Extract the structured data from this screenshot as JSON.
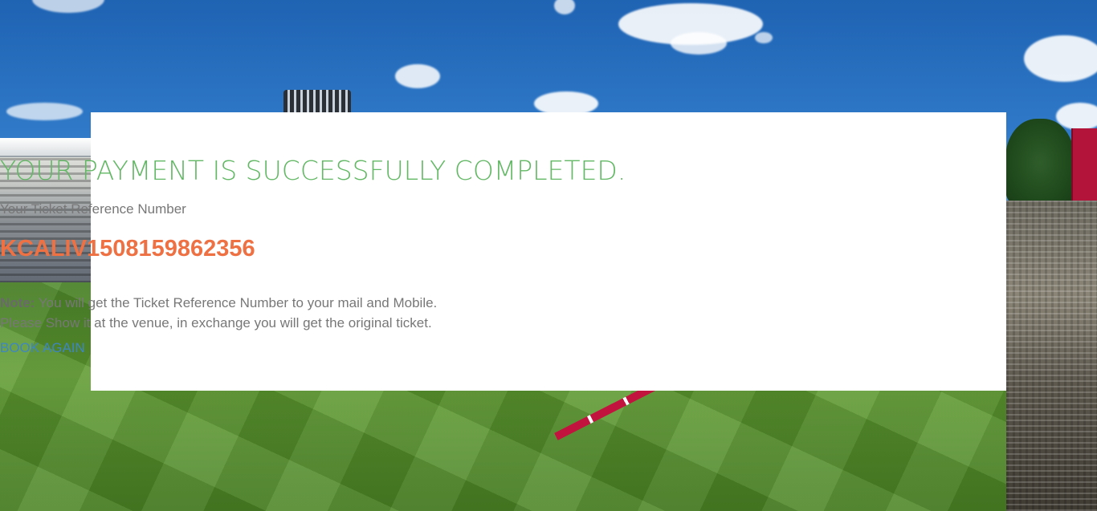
{
  "result": {
    "title": "YOUR PAYMENT IS SUCCESSFULLY COMPLETED.",
    "subtitle": "Your Ticket Reference Number",
    "reference_number": "KCALIV1508159862356",
    "note_label": "Note:",
    "note_line1": "You will get the Ticket Reference Number to your mail and Mobile.",
    "note_line2": "Please Show it at the venue, in exchange you will get the original ticket.",
    "book_again_label": "BOOK AGAIN"
  },
  "colors": {
    "title": "#63b865",
    "reference_number": "#ee7144",
    "link": "#3e86c2",
    "body_text": "#777777"
  }
}
